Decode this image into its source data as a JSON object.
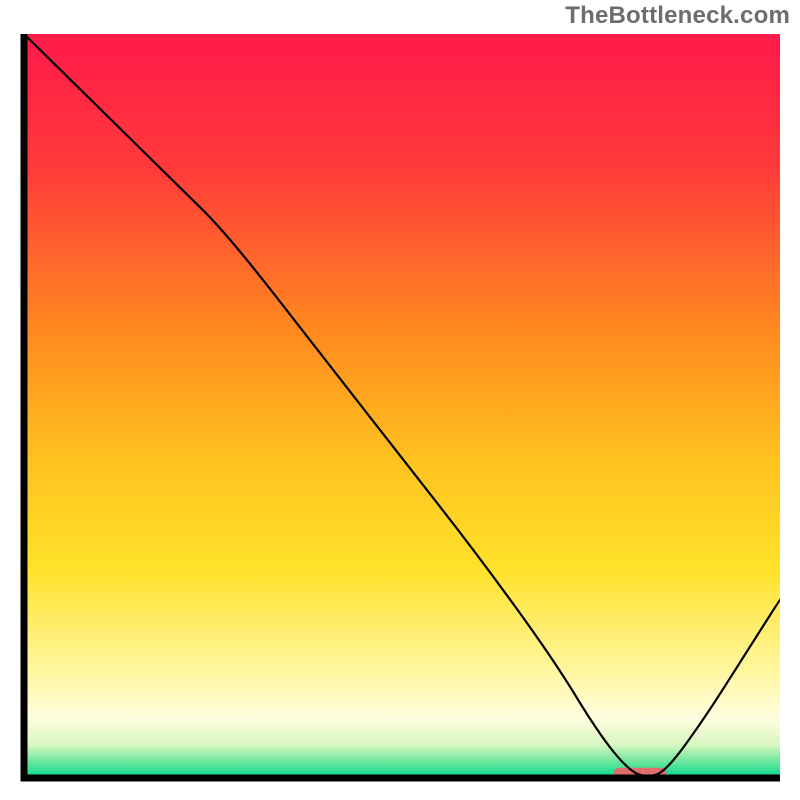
{
  "watermark": "TheBottleneck.com",
  "chart_data": {
    "type": "line",
    "title": "",
    "xlabel": "",
    "ylabel": "",
    "xlim": [
      0,
      100
    ],
    "ylim": [
      0,
      100
    ],
    "x": [
      0,
      10,
      20,
      27,
      40,
      50,
      60,
      70,
      76,
      80,
      82.5,
      85,
      90,
      95,
      100
    ],
    "values": [
      100,
      90,
      80,
      73,
      56,
      43,
      30,
      16,
      6,
      1,
      0,
      1,
      8,
      16,
      24
    ],
    "highlight_band": {
      "x_start": 78,
      "x_end": 85,
      "y": 0.7
    },
    "gradient_stops": [
      {
        "offset": 0.0,
        "color": "#ff1a4a"
      },
      {
        "offset": 0.18,
        "color": "#ff3a3a"
      },
      {
        "offset": 0.4,
        "color": "#ff8a1f"
      },
      {
        "offset": 0.58,
        "color": "#ffc41f"
      },
      {
        "offset": 0.72,
        "color": "#ffe22a"
      },
      {
        "offset": 0.86,
        "color": "#fff7a3"
      },
      {
        "offset": 0.92,
        "color": "#fffde0"
      },
      {
        "offset": 0.955,
        "color": "#d9f7c0"
      },
      {
        "offset": 0.975,
        "color": "#7ae8a0"
      },
      {
        "offset": 1.0,
        "color": "#00d98c"
      }
    ],
    "highlight_color": "#e06d6d",
    "axis_color": "#000000",
    "curve_color": "#000000",
    "curve_width": 2.2
  }
}
